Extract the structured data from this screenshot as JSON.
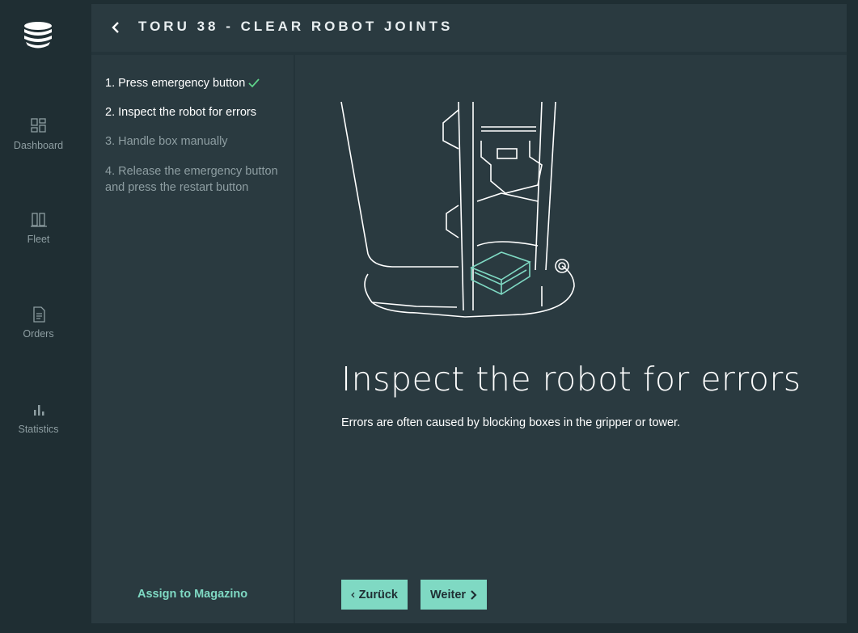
{
  "app": {
    "logo_icon": "magazino-logo-icon",
    "accent_color": "#7fd9c3"
  },
  "sidebar": {
    "items": [
      {
        "label": "Dashboard",
        "icon": "dashboard-grid-icon"
      },
      {
        "label": "Fleet",
        "icon": "fleet-icon"
      },
      {
        "label": "Orders",
        "icon": "document-icon"
      },
      {
        "label": "Statistics",
        "icon": "bar-chart-icon"
      }
    ]
  },
  "header": {
    "title": "TORU 38 - CLEAR ROBOT JOINTS",
    "back_icon": "chevron-left-icon"
  },
  "steps": [
    {
      "label": "1. Press emergency button",
      "state": "done"
    },
    {
      "label": "2. Inspect the robot for errors",
      "state": "active"
    },
    {
      "label": "3. Handle box manually",
      "state": "pending"
    },
    {
      "label": "4. Release the emergency button and press the restart button",
      "state": "pending"
    }
  ],
  "assign_link": "Assign to Magazino",
  "main": {
    "heading": "Inspect the robot for errors",
    "description": "Errors are often caused by blocking boxes in the gripper or tower.",
    "illustration_icon": "robot-line-drawing"
  },
  "buttons": {
    "back_label": "Zurück",
    "next_label": "Weiter"
  }
}
